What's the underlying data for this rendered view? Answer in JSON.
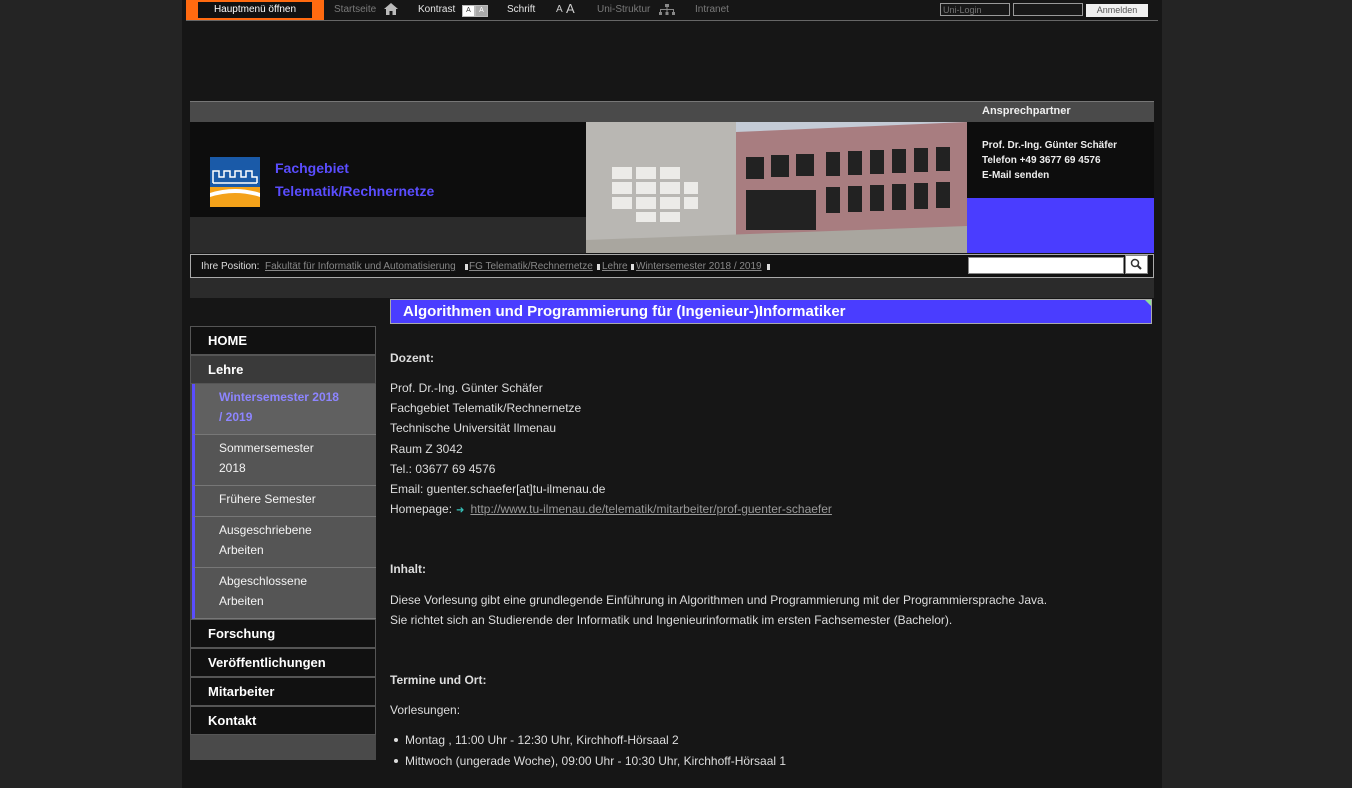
{
  "topbar": {
    "menu_label": "Hauptmenü öffnen",
    "home_label": "Startseite",
    "contrast_label": "Kontrast",
    "contrast_a1": "A",
    "contrast_a2": "A",
    "font_label": "Schrift",
    "font_small": "A",
    "font_large": "A",
    "structure_label": "Uni-Struktur",
    "intranet_label": "Intranet",
    "login_placeholder": "Uni-Login",
    "login_button": "Anmelden"
  },
  "header": {
    "contact_title": "Ansprechpartner",
    "department_line1": "Fachgebiet",
    "department_line2": "Telematik/Rechnernetze",
    "contact_name": "Prof. Dr.-Ing. Günter Schäfer",
    "contact_phone": "Telefon +49 3677 69 4576",
    "contact_email": "E-Mail senden"
  },
  "breadcrumb": {
    "label": "Ihre Position:",
    "items": [
      "Fakultät für Informatik und Automatisierung",
      "FG Telematik/Rechnernetze",
      "Lehre",
      "Wintersemester 2018 / 2019"
    ]
  },
  "sidebar": {
    "items": [
      "HOME",
      "Lehre",
      "Forschung",
      "Veröffentlichungen",
      "Mitarbeiter",
      "Kontakt"
    ],
    "subitems": [
      [
        "Wintersemester 2018",
        "/ 2019"
      ],
      [
        "Sommersemester",
        "2018"
      ],
      [
        "Frühere Semester"
      ],
      [
        "Ausgeschriebene",
        "Arbeiten"
      ],
      [
        "Abgeschlossene",
        "Arbeiten"
      ]
    ]
  },
  "main": {
    "title": "Algorithmen und Programmierung für (Ingenieur-)Informatiker",
    "dozent_heading": "Dozent:",
    "dozent_lines": [
      "Prof. Dr.-Ing. Günter Schäfer",
      "Fachgebiet Telematik/Rechnernetze",
      "Technische Universität Ilmenau",
      "Raum Z 3042",
      "Tel.: 03677 69 4576",
      "Email: guenter.schaefer[at]tu-ilmenau.de"
    ],
    "homepage_label": "Homepage:",
    "homepage_url": "http://www.tu-ilmenau.de/telematik/mitarbeiter/prof-guenter-schaefer",
    "inhalt_heading": "Inhalt:",
    "inhalt_lines": [
      "Diese Vorlesung gibt eine grundlegende Einführung in Algorithmen und Programmierung mit der Programmiersprache Java.",
      "Sie richtet sich an Studierende der Informatik und Ingenieurinformatik im ersten Fachsemester (Bachelor)."
    ],
    "termine_heading": "Termine und Ort:",
    "vorlesungen_label": "Vorlesungen:",
    "lectures": [
      "Montag , 11:00 Uhr - 12:30 Uhr, Kirchhoff-Hörsaal 2",
      "Mittwoch (ungerade Woche), 09:00 Uhr - 10:30 Uhr, Kirchhoff-Hörsaal 1"
    ]
  },
  "colors": {
    "accent": "#4a3dff",
    "menu_orange": "#ff6a10"
  }
}
